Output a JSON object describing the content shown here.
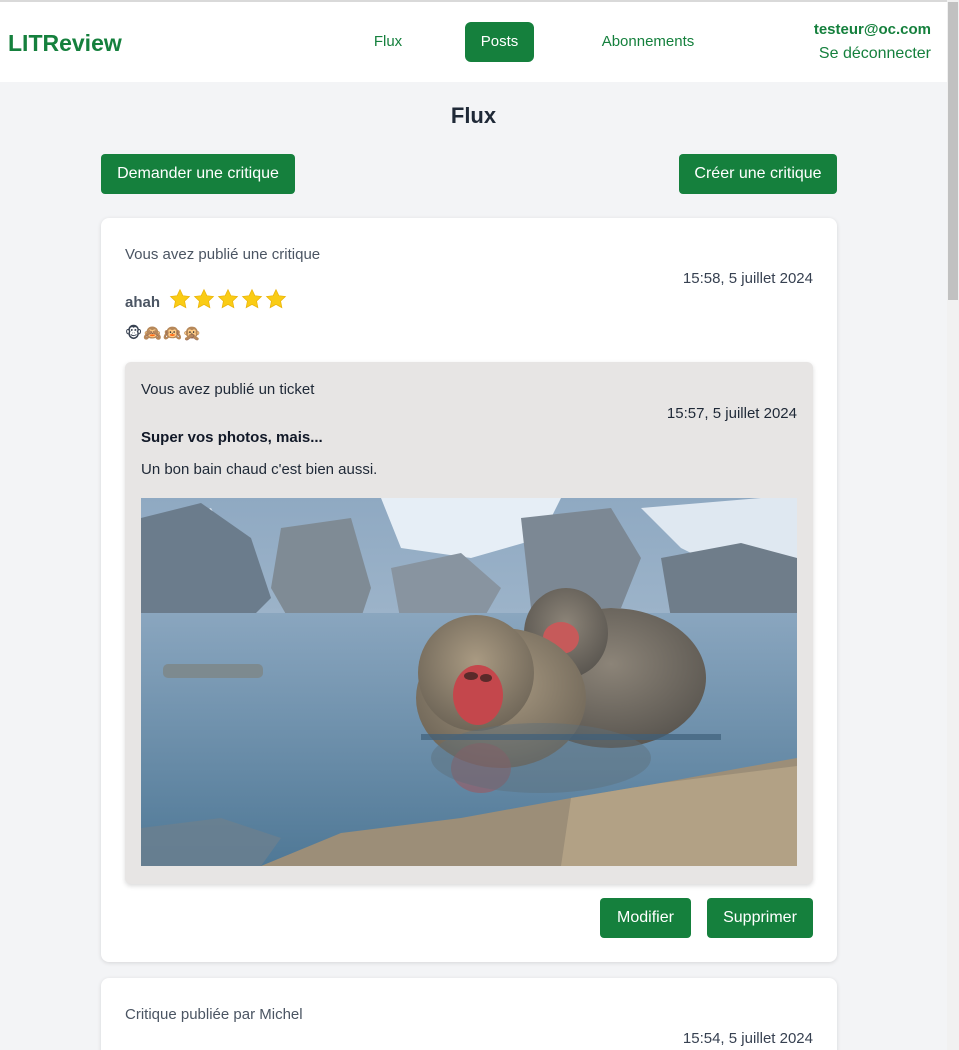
{
  "navbar": {
    "brand": "LITReview",
    "links": [
      {
        "label": "Flux",
        "active": false
      },
      {
        "label": "Posts",
        "active": true
      },
      {
        "label": "Abonnements",
        "active": false
      }
    ],
    "user_email": "testeur@oc.com",
    "logout_label": "Se déconnecter"
  },
  "page": {
    "title": "Flux",
    "request_button": "Demander une critique",
    "create_button": "Créer une critique"
  },
  "posts": [
    {
      "meta": "Vous avez publié une critique",
      "date": "15:58, 5 juillet 2024",
      "headline": "ahah",
      "rating": 5,
      "body": "🐵🙈🙉🙊",
      "ticket": {
        "meta": "Vous avez publié un ticket",
        "date": "15:57, 5 juillet 2024",
        "title": "Super vos photos, mais...",
        "description": "Un bon bain chaud c'est bien aussi."
      },
      "edit_label": "Modifier",
      "delete_label": "Supprimer"
    },
    {
      "meta": "Critique publiée par Michel",
      "date": "15:54, 5 juillet 2024"
    }
  ],
  "colors": {
    "accent": "#15803d",
    "star": "#facc15",
    "background": "#f3f4f6",
    "ticket_bg": "#e7e5e4"
  }
}
